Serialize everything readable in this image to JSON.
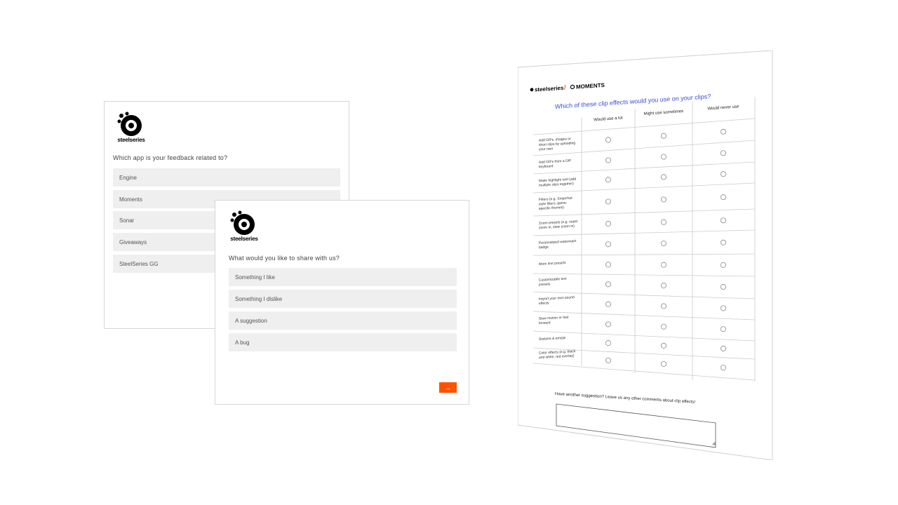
{
  "brand": {
    "name": "steelseries",
    "accent_color": "#ff5200"
  },
  "card_app": {
    "question": "Which app is your feedback related to?",
    "options": [
      "Engine",
      "Moments",
      "Sonar",
      "Giveaways",
      "SteelSeries GG"
    ]
  },
  "card_share": {
    "question": "What would you like to share with us?",
    "options": [
      "Something I like",
      "Something I dislike",
      "A suggestion",
      "A bug"
    ],
    "next_label": "→"
  },
  "survey": {
    "header_brand": "steelseries",
    "header_sep": "/",
    "header_product": "MOMENTS",
    "question": "Which of these clip effects would you use on your clips?",
    "columns": [
      "Would use a lot",
      "Might use sometimes",
      "Would never use"
    ],
    "rows": [
      [
        "Add GIFs, images or",
        "short clips by uploading",
        "your own"
      ],
      [
        "Add GIFs from a GIF",
        "keyboard"
      ],
      [
        "Make highlight reel (add",
        "multiple clips together)"
      ],
      [
        "Filters (e.g. Snapchat-",
        "style filters, game-",
        "specific themes)"
      ],
      [
        "Zoom presets (e.g. super",
        "zoom in, slow zoom-in)"
      ],
      [
        "Personalized watermark",
        "badge"
      ],
      [
        "More text presets"
      ],
      [
        "Customizable text",
        "presets"
      ],
      [
        "Import your own sound",
        "effects"
      ],
      [
        "Slow motion or fast",
        "forward"
      ],
      [
        "Stickers & emojis"
      ],
      [
        "Color effects (e.g. black",
        "and white, red overlay)"
      ]
    ],
    "comment_prompt": "Have another suggestion?  Leave us any other comments about clip effects!"
  }
}
